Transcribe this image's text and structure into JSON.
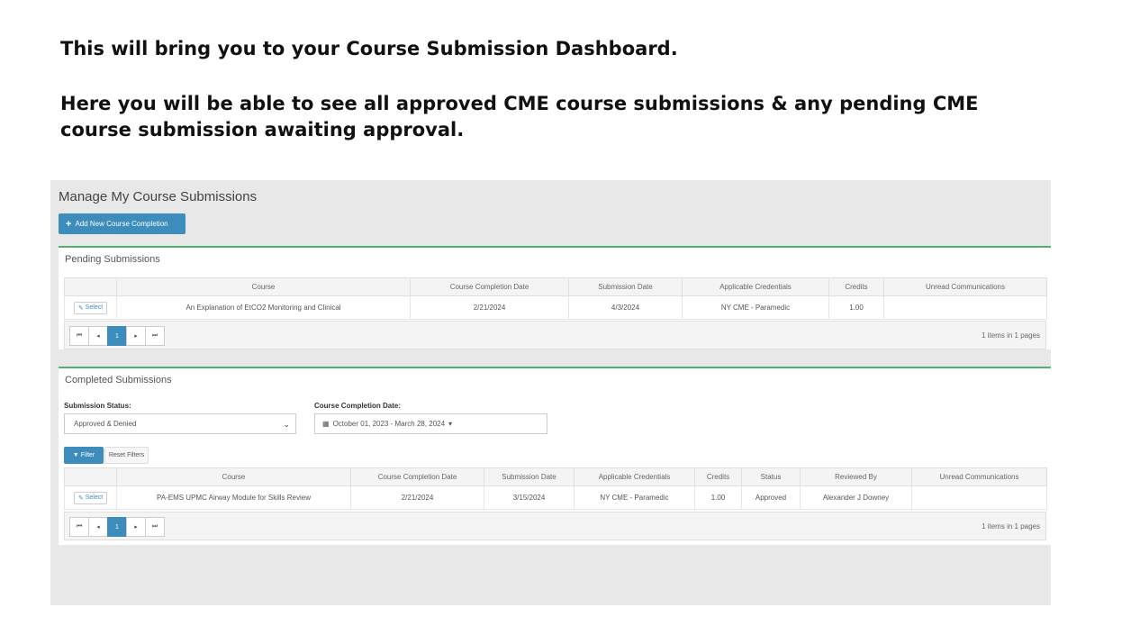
{
  "slide": {
    "intro": "This will bring you to your Course Submission Dashboard.",
    "description": "Here you will be able to see all approved CME course submissions & any pending CME course submission awaiting approval."
  },
  "page": {
    "title": "Manage My Course Submissions",
    "add_button": "Add New Course Completion"
  },
  "pending": {
    "title": "Pending Submissions",
    "columns": [
      "",
      "Course",
      "Course Completion Date",
      "Submission Date",
      "Applicable Credentials",
      "Credits",
      "Unread Communications"
    ],
    "row": {
      "select": "Select",
      "course": "An Explanation of EtCO2 Monitoring and Clinical",
      "completion_date": "2/21/2024",
      "submission_date": "4/3/2024",
      "credentials": "NY CME - Paramedic",
      "credits": "1.00",
      "unread": ""
    },
    "pager": {
      "first": "⏮",
      "prev": "◂",
      "page": "1",
      "next": "▸",
      "last": "⏭",
      "info": "1 items in 1 pages"
    }
  },
  "completed": {
    "title": "Completed Submissions",
    "status_label": "Submission Status:",
    "status_value": "Approved & Denied",
    "date_label": "Course Completion Date:",
    "date_value": "October 01, 2023 - March 28, 2024",
    "filter_button": "Filter",
    "reset_button": "Reset Filters",
    "columns": [
      "",
      "Course",
      "Course Completion Date",
      "Submission Date",
      "Applicable Credentials",
      "Credits",
      "Status",
      "Reviewed By",
      "Unread Communications"
    ],
    "row": {
      "select": "Select",
      "course": "PA-EMS UPMC Airway Module for Skills Review",
      "completion_date": "2/21/2024",
      "submission_date": "3/15/2024",
      "credentials": "NY CME - Paramedic",
      "credits": "1.00",
      "status": "Approved",
      "reviewed_by": "Alexander J Downey",
      "unread": ""
    },
    "pager": {
      "first": "⏮",
      "prev": "◂",
      "page": "1",
      "next": "▸",
      "last": "⏭",
      "info": "1 items in 1 pages"
    }
  },
  "colors": {
    "primary": "#3c8dbc",
    "panel_accent": "#4fb270",
    "background": "#e8e8e8"
  }
}
